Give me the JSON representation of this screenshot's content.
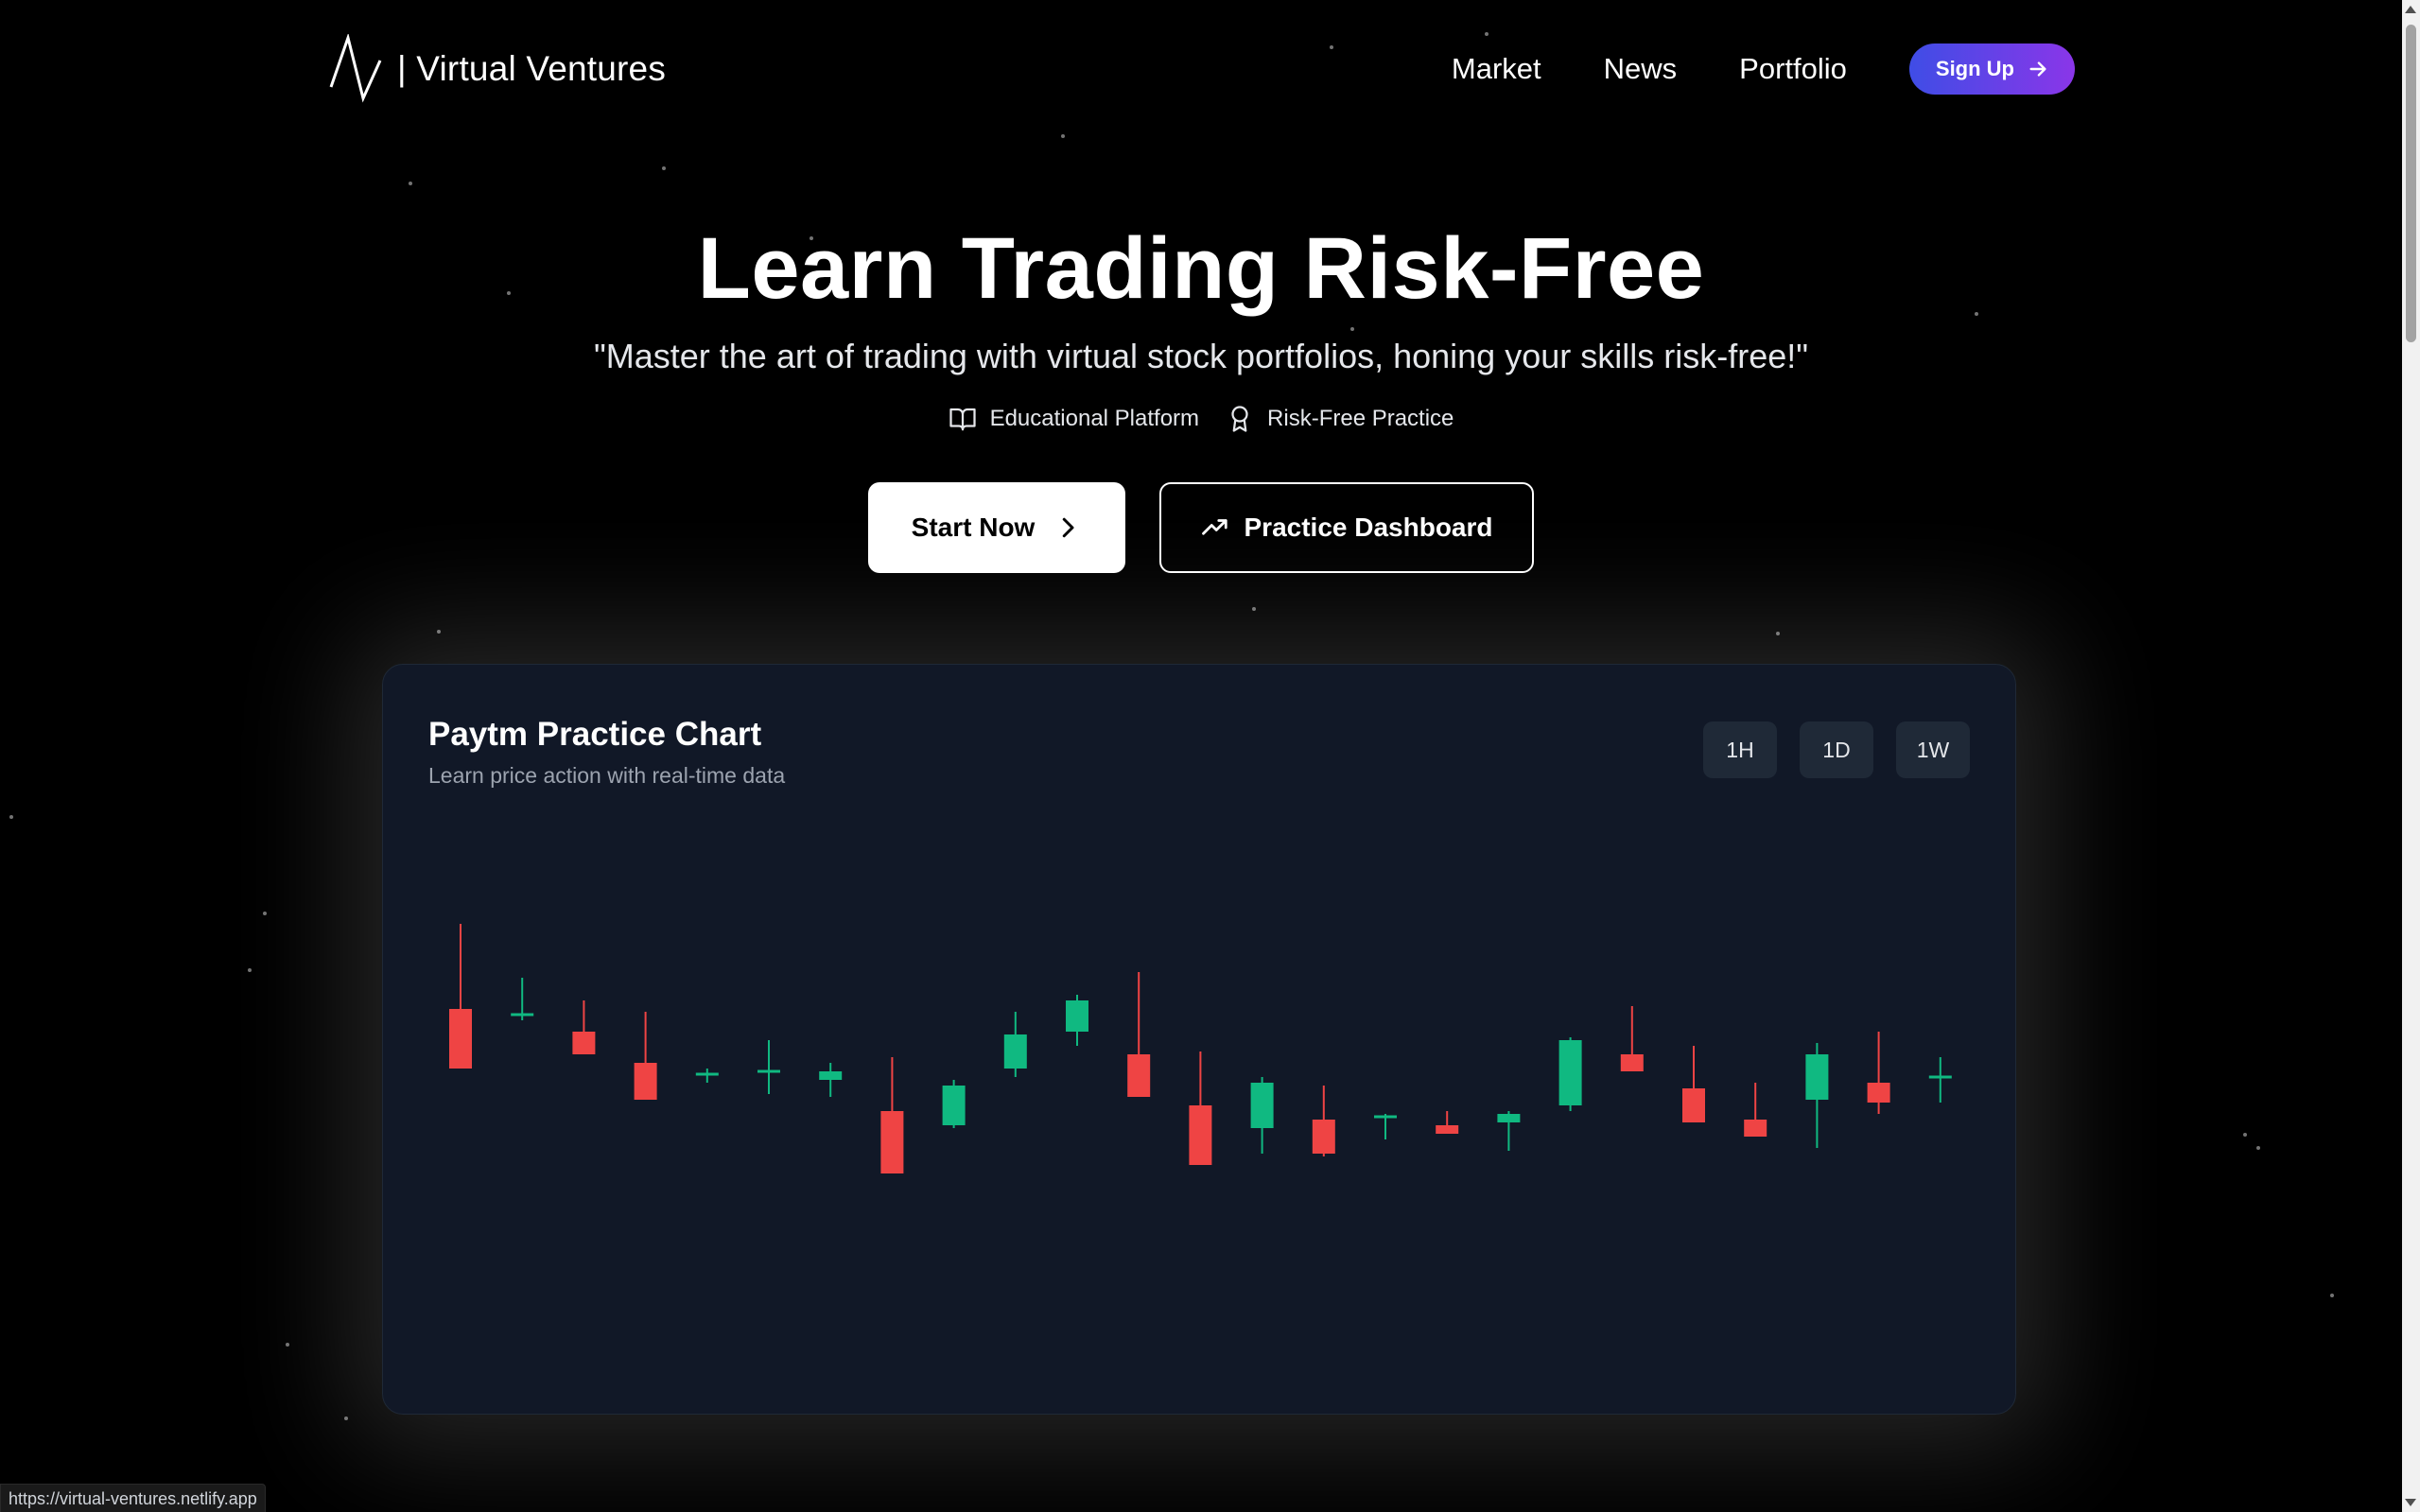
{
  "browser": {
    "status_url": "https://virtual-ventures.netlify.app"
  },
  "nav": {
    "brand": "| Virtual Ventures",
    "links": [
      "Market",
      "News",
      "Portfolio"
    ],
    "signup_label": "Sign Up",
    "signup_gradient": [
      "#3f4de6",
      "#8a36e8"
    ]
  },
  "hero": {
    "title": "Learn Trading Risk-Free",
    "subtitle": "\"Master the art of trading with virtual stock portfolios, honing your skills risk-free!\"",
    "tags": [
      {
        "label": "Educational Platform",
        "icon": "book-open-icon"
      },
      {
        "label": "Risk-Free Practice",
        "icon": "award-icon"
      }
    ],
    "primary_cta": "Start Now",
    "secondary_cta": "Practice Dashboard"
  },
  "chart_card": {
    "title": "Paytm Practice Chart",
    "subtitle": "Learn price action with real-time data",
    "timeframes": [
      "1H",
      "1D",
      "1W"
    ]
  },
  "colors": {
    "background": "#000000",
    "card": "#111827",
    "up": "#10b981",
    "down": "#ef4444"
  },
  "chart_data": {
    "type": "candlestick",
    "title": "Paytm Practice Chart",
    "candles": [
      {
        "open": 172,
        "close": 151,
        "high": 202,
        "low": 151
      },
      {
        "open": 170,
        "close": 170,
        "high": 183,
        "low": 168
      },
      {
        "open": 164,
        "close": 156,
        "high": 175,
        "low": 156
      },
      {
        "open": 153,
        "close": 140,
        "high": 171,
        "low": 140
      },
      {
        "open": 149,
        "close": 149,
        "high": 151,
        "low": 146
      },
      {
        "open": 150,
        "close": 150,
        "high": 161,
        "low": 142
      },
      {
        "open": 147,
        "close": 150,
        "high": 153,
        "low": 141
      },
      {
        "open": 136,
        "close": 114,
        "high": 155,
        "low": 114
      },
      {
        "open": 131,
        "close": 145,
        "high": 147,
        "low": 130
      },
      {
        "open": 151,
        "close": 163,
        "high": 171,
        "low": 148
      },
      {
        "open": 164,
        "close": 175,
        "high": 177,
        "low": 159
      },
      {
        "open": 156,
        "close": 141,
        "high": 185,
        "low": 141
      },
      {
        "open": 138,
        "close": 117,
        "high": 157,
        "low": 117
      },
      {
        "open": 130,
        "close": 146,
        "high": 148,
        "low": 121
      },
      {
        "open": 133,
        "close": 121,
        "high": 145,
        "low": 120
      },
      {
        "open": 134,
        "close": 134,
        "high": 135,
        "low": 126
      },
      {
        "open": 131,
        "close": 128,
        "high": 136,
        "low": 128
      },
      {
        "open": 132,
        "close": 135,
        "high": 136,
        "low": 122
      },
      {
        "open": 138,
        "close": 161,
        "high": 162,
        "low": 136
      },
      {
        "open": 156,
        "close": 150,
        "high": 173,
        "low": 150
      },
      {
        "open": 144,
        "close": 132,
        "high": 159,
        "low": 132
      },
      {
        "open": 133,
        "close": 127,
        "high": 146,
        "low": 127
      },
      {
        "open": 140,
        "close": 156,
        "high": 160,
        "low": 123
      },
      {
        "open": 146,
        "close": 139,
        "high": 164,
        "low": 135
      },
      {
        "open": 148,
        "close": 148,
        "high": 155,
        "low": 139
      }
    ],
    "ylim": [
      60,
      260
    ],
    "grid": false,
    "legend": "none"
  }
}
